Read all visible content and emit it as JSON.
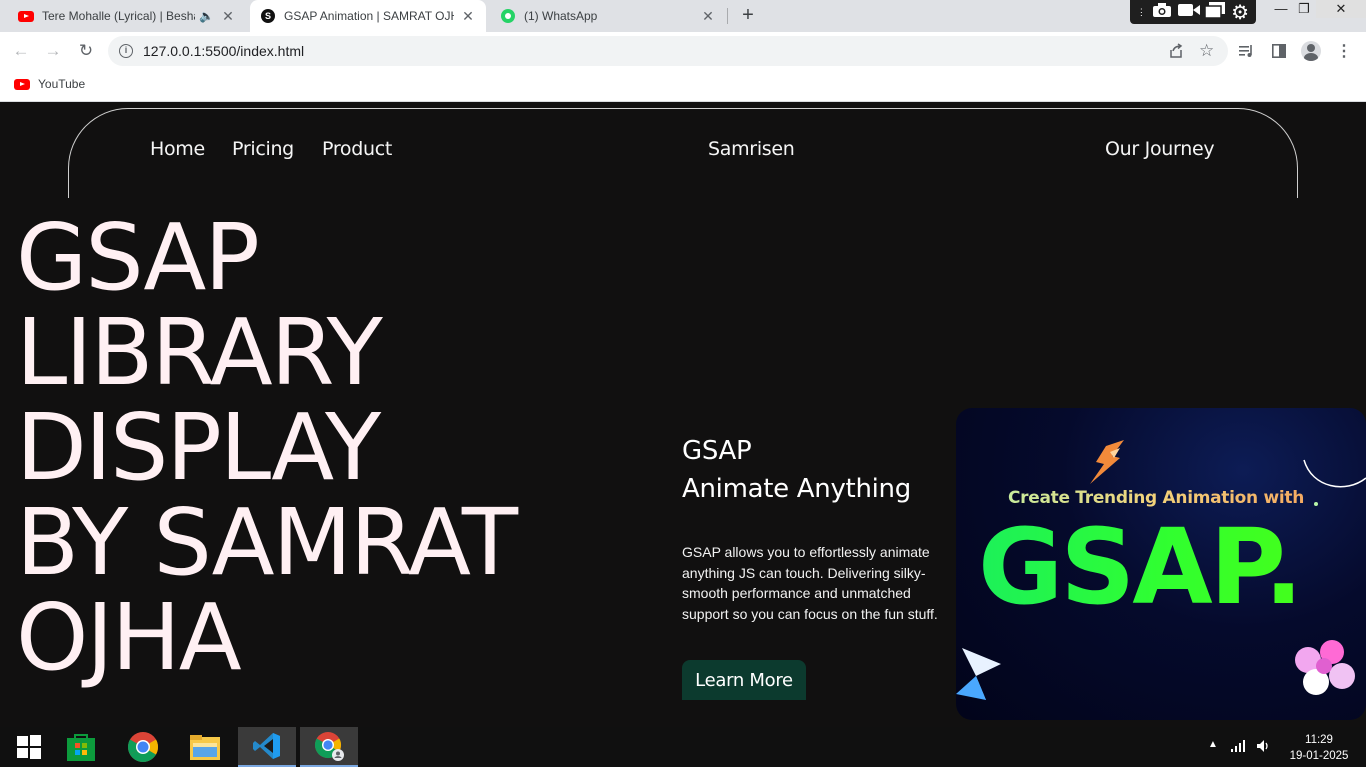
{
  "browser": {
    "tabs": [
      {
        "title": "Tere Mohalle (Lyrical) | Besha",
        "favicon": "youtube-icon",
        "audio": true,
        "active": false
      },
      {
        "title": "GSAP Animation | SAMRAT OJHA",
        "favicon": "s-logo-icon",
        "active": true
      },
      {
        "title": "(1) WhatsApp",
        "favicon": "whatsapp-icon",
        "active": false
      }
    ],
    "url": "127.0.0.1:5500/index.html",
    "bookmarks": [
      {
        "label": "YouTube"
      }
    ]
  },
  "site": {
    "nav": {
      "links": [
        "Home",
        "Pricing",
        "Product"
      ],
      "brand": "Samrisen",
      "journey": "Our Journey"
    },
    "hero": {
      "lines": [
        "GSAP",
        "LIBRARY",
        "DISPLAY",
        "BY SAMRAT",
        "OJHA"
      ]
    },
    "feature": {
      "title_line1": "GSAP",
      "title_line2": "Animate Anything",
      "description": "GSAP allows you to effortlessly animate anything JS can touch. Delivering silky-smooth performance and unmatched support so you can focus on the fun stuff.",
      "cta": "Learn More"
    },
    "promo": {
      "subtitle": "Create Trending Animation with",
      "headline": "GSAP."
    },
    "colors": {
      "background": "#111010",
      "hero_text": "#fff0f3",
      "cta_bg": "#0c3a2e",
      "promo_green": "#31ff2f"
    }
  },
  "taskbar": {
    "time": "11:29",
    "date": "19-01-2025",
    "apps": [
      "windows-start-icon",
      "store-icon",
      "chrome-icon",
      "file-explorer-icon",
      "vscode-icon",
      "chrome-profile-icon"
    ]
  }
}
